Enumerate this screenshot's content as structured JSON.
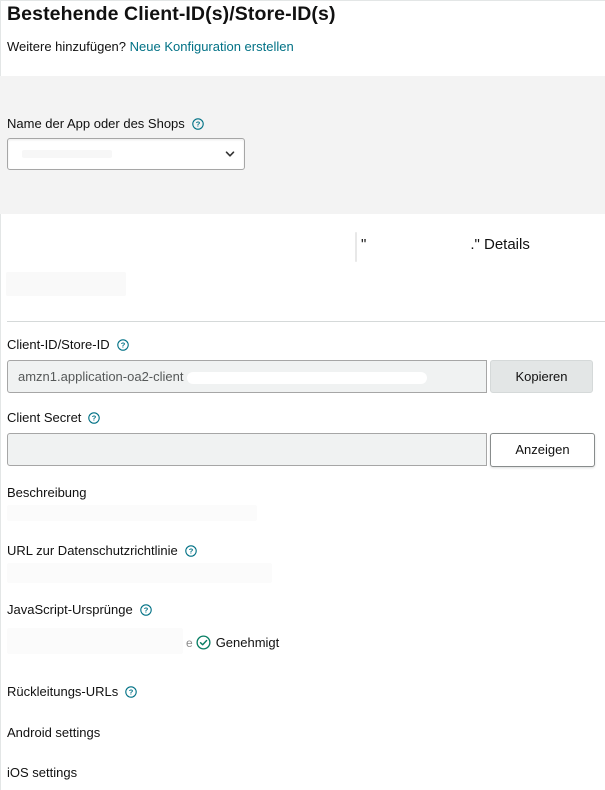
{
  "header": {
    "title": "Bestehende Client-ID(s)/Store-ID(s)",
    "add_prompt": "Weitere hinzufügen?",
    "add_link": "Neue Konfiguration erstellen"
  },
  "selector": {
    "label": "Name der App oder des Shops",
    "selected_value": ""
  },
  "details": {
    "title_open": "\"",
    "title_close": ".\" Details"
  },
  "fields": {
    "client_id": {
      "label": "Client-ID/Store-ID",
      "value_prefix": "amzn1.application-oa2-client",
      "button": "Kopieren"
    },
    "client_secret": {
      "label": "Client Secret",
      "value": "",
      "button": "Anzeigen"
    },
    "description": {
      "label": "Beschreibung"
    },
    "privacy_url": {
      "label": "URL zur Datenschutzrichtlinie"
    },
    "js_origins": {
      "label": "JavaScript-Ursprünge",
      "origin_tail": "e",
      "status": "Genehmigt"
    },
    "return_urls": {
      "label": "Rückleitungs-URLs"
    },
    "android": {
      "label": "Android settings"
    },
    "ios": {
      "label": "iOS settings"
    }
  },
  "colors": {
    "link": "#007185",
    "success": "#067d62",
    "panel_bg": "#f3f3f3",
    "field_bg": "#f0f2f2",
    "copy_button_bg": "#e3e6e6"
  },
  "icons": {
    "help": "help-circle-icon",
    "dropdown": "chevron-down-icon",
    "status": "check-circle-icon"
  }
}
